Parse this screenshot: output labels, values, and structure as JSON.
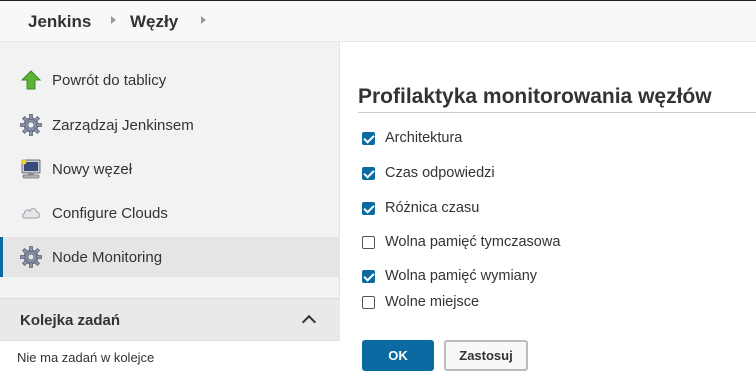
{
  "breadcrumb": {
    "items": [
      "Jenkins",
      "Węzły"
    ]
  },
  "sidebar": {
    "tasks": [
      {
        "label": "Powrót do tablicy",
        "icon": "up-arrow-icon"
      },
      {
        "label": "Zarządzaj Jenkinsem",
        "icon": "gear-icon"
      },
      {
        "label": "Nowy węzeł",
        "icon": "computer-icon"
      },
      {
        "label": "Configure Clouds",
        "icon": "cloud-icon"
      },
      {
        "label": "Node Monitoring",
        "icon": "gear-icon",
        "active": true
      }
    ],
    "queue": {
      "title": "Kolejka zadań",
      "empty_text": "Nie ma zadań w kolejce",
      "expanded": true
    }
  },
  "main": {
    "title": "Profilaktyka monitorowania węzłów",
    "monitors": [
      {
        "label": "Architektura",
        "checked": true
      },
      {
        "label": "Czas odpowiedzi",
        "checked": true
      },
      {
        "label": "Różnica czasu",
        "checked": true
      },
      {
        "label": "Wolna pamięć tymczasowa",
        "checked": false
      },
      {
        "label": "Wolna pamięć wymiany",
        "checked": true
      },
      {
        "label": "Wolne miejsce",
        "checked": false
      }
    ],
    "ok_label": "OK",
    "apply_label": "Zastosuj"
  },
  "colors": {
    "accent": "#0b6aa2",
    "sidebar_bg": "#f2f2f2",
    "active_item_bg": "#e5e5e5"
  }
}
